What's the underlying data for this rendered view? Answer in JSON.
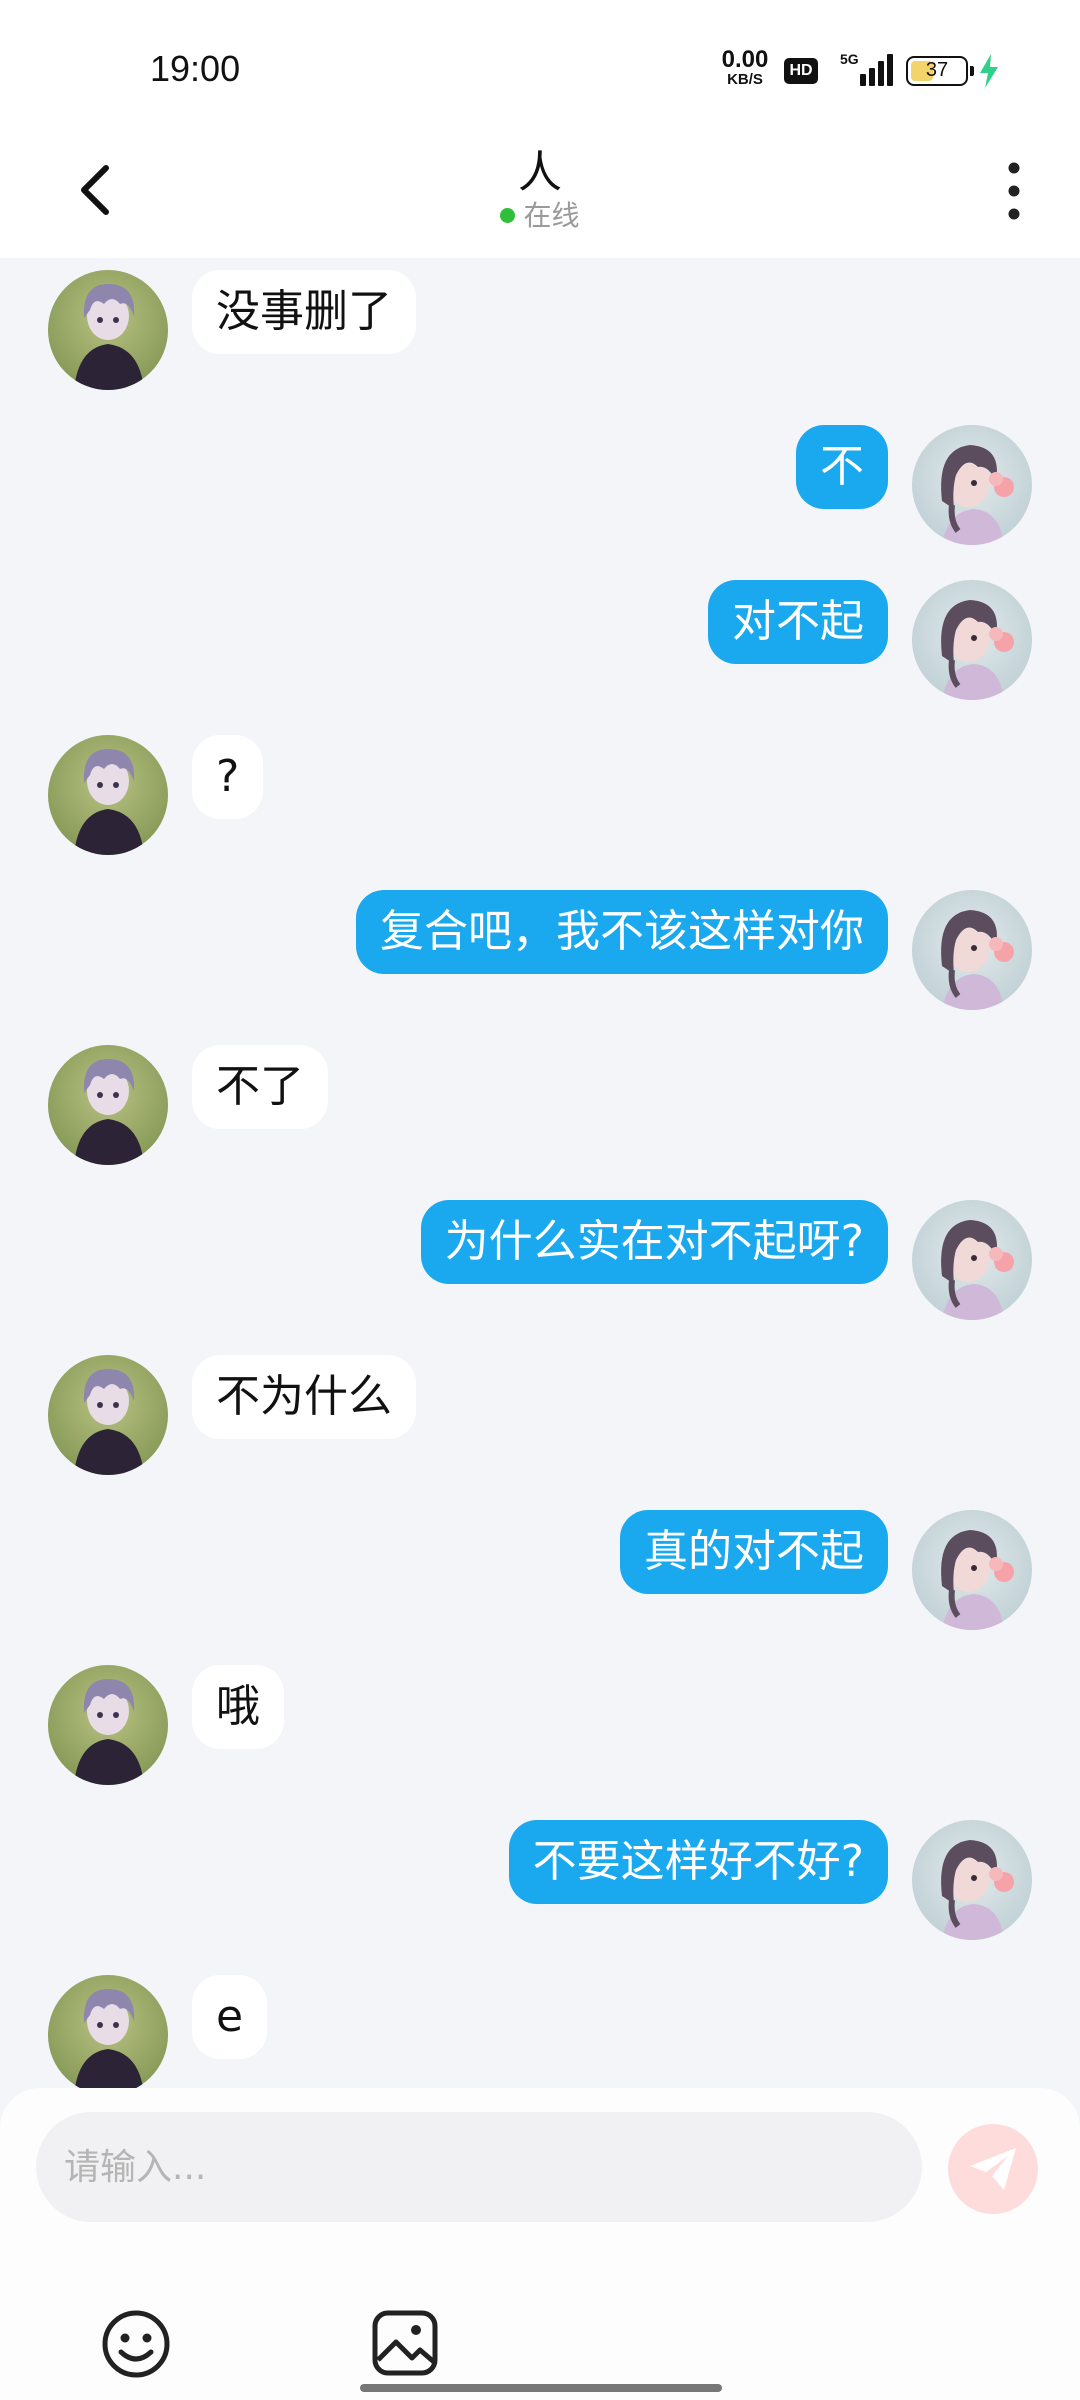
{
  "status_bar": {
    "time": "19:00",
    "net_speed_value": "0.00",
    "net_speed_unit": "KB/S",
    "hd_label": "HD",
    "network_label": "5G",
    "battery_level": "37",
    "charging": true
  },
  "header": {
    "title": "人",
    "status": "在线",
    "status_color": "#2fbf3b"
  },
  "messages": [
    {
      "side": "in",
      "text": "没事删了"
    },
    {
      "side": "out",
      "text": "不"
    },
    {
      "side": "out",
      "text": "对不起"
    },
    {
      "side": "in",
      "text": "?"
    },
    {
      "side": "out",
      "text": "复合吧，我不该这样对你"
    },
    {
      "side": "in",
      "text": "不了"
    },
    {
      "side": "out",
      "text": "为什么实在对不起呀?"
    },
    {
      "side": "in",
      "text": "不为什么"
    },
    {
      "side": "out",
      "text": "真的对不起"
    },
    {
      "side": "in",
      "text": "哦"
    },
    {
      "side": "out",
      "text": "不要这样好不好?"
    },
    {
      "side": "in",
      "text": "e"
    }
  ],
  "composer": {
    "placeholder": "请输入...",
    "send_icon": "paper-plane-icon",
    "emoji_icon": "smiley-icon",
    "image_icon": "image-icon"
  },
  "colors": {
    "outgoing_bubble": "#1aa8ef",
    "incoming_bubble": "#ffffff",
    "chat_background": "#f3f5f8",
    "send_button": "#ffdcdc"
  }
}
